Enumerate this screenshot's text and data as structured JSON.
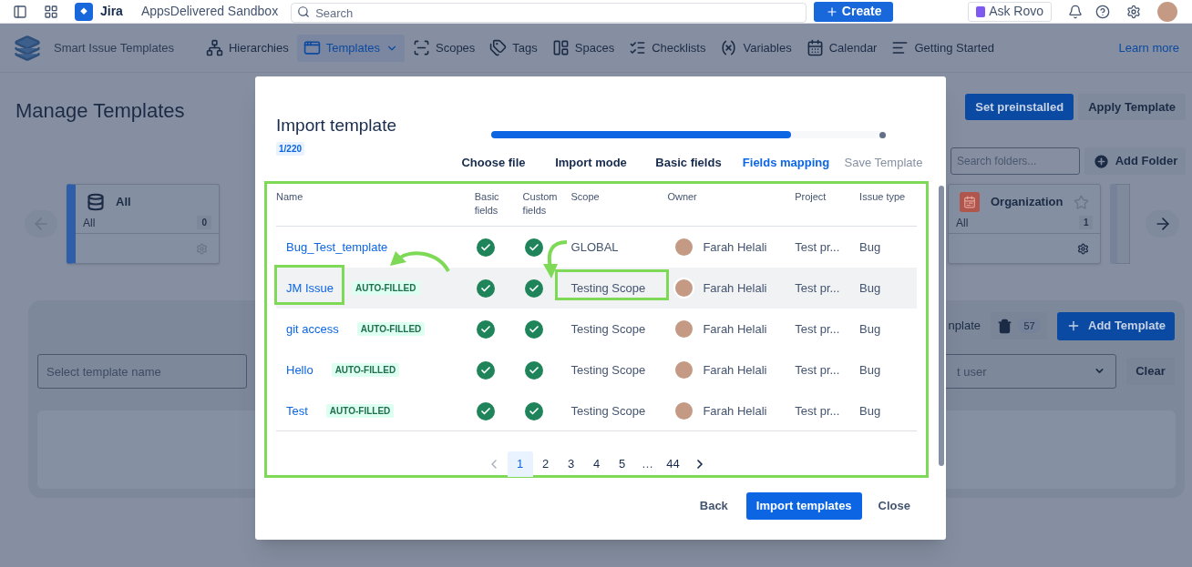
{
  "top_bar": {
    "product": "Jira",
    "site": "AppsDelivered Sandbox",
    "search_placeholder": "Search",
    "create_button": "Create",
    "ask_button": "Ask Rovo"
  },
  "nav": {
    "brand": "Smart Issue Templates",
    "items": [
      {
        "label": "Hierarchies",
        "selected": false,
        "dropdown": false
      },
      {
        "label": "Templates",
        "selected": true,
        "dropdown": true
      },
      {
        "label": "Scopes",
        "selected": false,
        "dropdown": false
      },
      {
        "label": "Tags",
        "selected": false,
        "dropdown": false
      },
      {
        "label": "Spaces",
        "selected": false,
        "dropdown": false
      },
      {
        "label": "Checklists",
        "selected": false,
        "dropdown": false
      },
      {
        "label": "Variables",
        "selected": false,
        "dropdown": false
      },
      {
        "label": "Calendar",
        "selected": false,
        "dropdown": false
      },
      {
        "label": "Getting Started",
        "selected": false,
        "dropdown": false
      }
    ],
    "learn_more": "Learn more"
  },
  "page": {
    "title": "Manage Templates",
    "actions": [
      "Set preinstalled",
      "Apply Template"
    ],
    "folder_search_placeholder": "Search folders...",
    "add_folder": "Add Folder",
    "folders": [
      {
        "kind": "all",
        "name": "All",
        "scope": "All",
        "count": "0",
        "selected": true
      },
      {
        "kind": "organization",
        "name": "Organization",
        "scope": "All",
        "count": "1",
        "selected": false,
        "starred": false
      }
    ],
    "templates": {
      "toolbar_label": "nplate",
      "trash_count": "57",
      "add_button": "Add Template",
      "name_placeholder": "Select template name",
      "user_placeholder": "t user",
      "clear_button": "Clear"
    }
  },
  "modal": {
    "title": "Import template",
    "counter": "1/220",
    "progress": {
      "level": 0.76
    },
    "steps": [
      {
        "label": "Choose file",
        "completed": true,
        "active": false
      },
      {
        "label": "Import mode",
        "completed": true,
        "active": false
      },
      {
        "label": "Basic fields",
        "completed": true,
        "active": false
      },
      {
        "label": "Fields mapping",
        "completed": false,
        "active": true
      },
      {
        "label": "Save Template",
        "completed": false,
        "active": false
      }
    ],
    "columns": [
      "Name",
      "Basic fields",
      "Custom fields",
      "Scope",
      "Owner",
      "Project",
      "Issue type"
    ],
    "rows": [
      {
        "name": "Bug_Test_template",
        "basic_fields": true,
        "custom_fields": true,
        "scope": "GLOBAL",
        "owner": "Farah Helali",
        "project": "Test pr...",
        "issue_type": "Bug",
        "selected": false
      },
      {
        "name": "JM Issue",
        "badge": "AUTO-FILLED",
        "basic_fields": true,
        "custom_fields": true,
        "scope": "Testing Scope",
        "owner": "Farah Helali",
        "project": "Test pr...",
        "issue_type": "Bug",
        "selected": true
      },
      {
        "name": "git access",
        "badge": "AUTO-FILLED",
        "basic_fields": true,
        "custom_fields": true,
        "scope": "Testing Scope",
        "owner": "Farah Helali",
        "project": "Test pr...",
        "issue_type": "Bug",
        "selected": false
      },
      {
        "name": "Hello",
        "badge": "AUTO-FILLED",
        "basic_fields": true,
        "custom_fields": true,
        "scope": "Testing Scope",
        "owner": "Farah Helali",
        "project": "Test pr...",
        "issue_type": "Bug",
        "selected": false
      },
      {
        "name": "Test",
        "badge": "AUTO-FILLED",
        "basic_fields": true,
        "custom_fields": true,
        "scope": "Testing Scope",
        "owner": "Farah Helali",
        "project": "Test pr...",
        "issue_type": "Bug",
        "selected": false
      }
    ],
    "pagination": {
      "prev_disabled": true,
      "next_disabled": false,
      "pages": [
        {
          "kind": "page",
          "label": "1",
          "selected": true
        },
        {
          "kind": "page",
          "label": "2",
          "selected": false
        },
        {
          "kind": "page",
          "label": "3",
          "selected": false
        },
        {
          "kind": "page",
          "label": "4",
          "selected": false
        },
        {
          "kind": "page",
          "label": "5",
          "selected": false
        },
        {
          "kind": "ellipsis",
          "label": "…",
          "selected": false
        },
        {
          "kind": "page",
          "label": "44",
          "selected": false
        }
      ]
    },
    "footer": {
      "back": "Back",
      "import": "Import templates",
      "close": "Close"
    }
  }
}
